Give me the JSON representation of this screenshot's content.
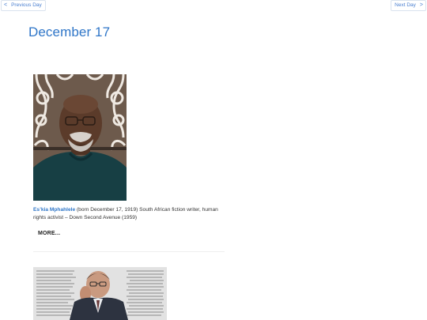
{
  "nav": {
    "prev_arrow": "<",
    "prev_label": "Previous Day",
    "next_label": "Next Day",
    "next_arrow": ">"
  },
  "page_title": "December 17",
  "entries": [
    {
      "photo_alt": "Es'kia Mphahlele",
      "name": "Es’kia Mphahlele",
      "description": " (born December 17, 1919) South African fiction writer, human rights activist – Down Second Avenue (1959)",
      "more_label": "MORE..."
    },
    {
      "photo_alt": "Author portrait with newspaper background"
    }
  ],
  "colors": {
    "accent": "#2f76c8",
    "nav_border": "#d9e2ee",
    "text": "#333333"
  }
}
